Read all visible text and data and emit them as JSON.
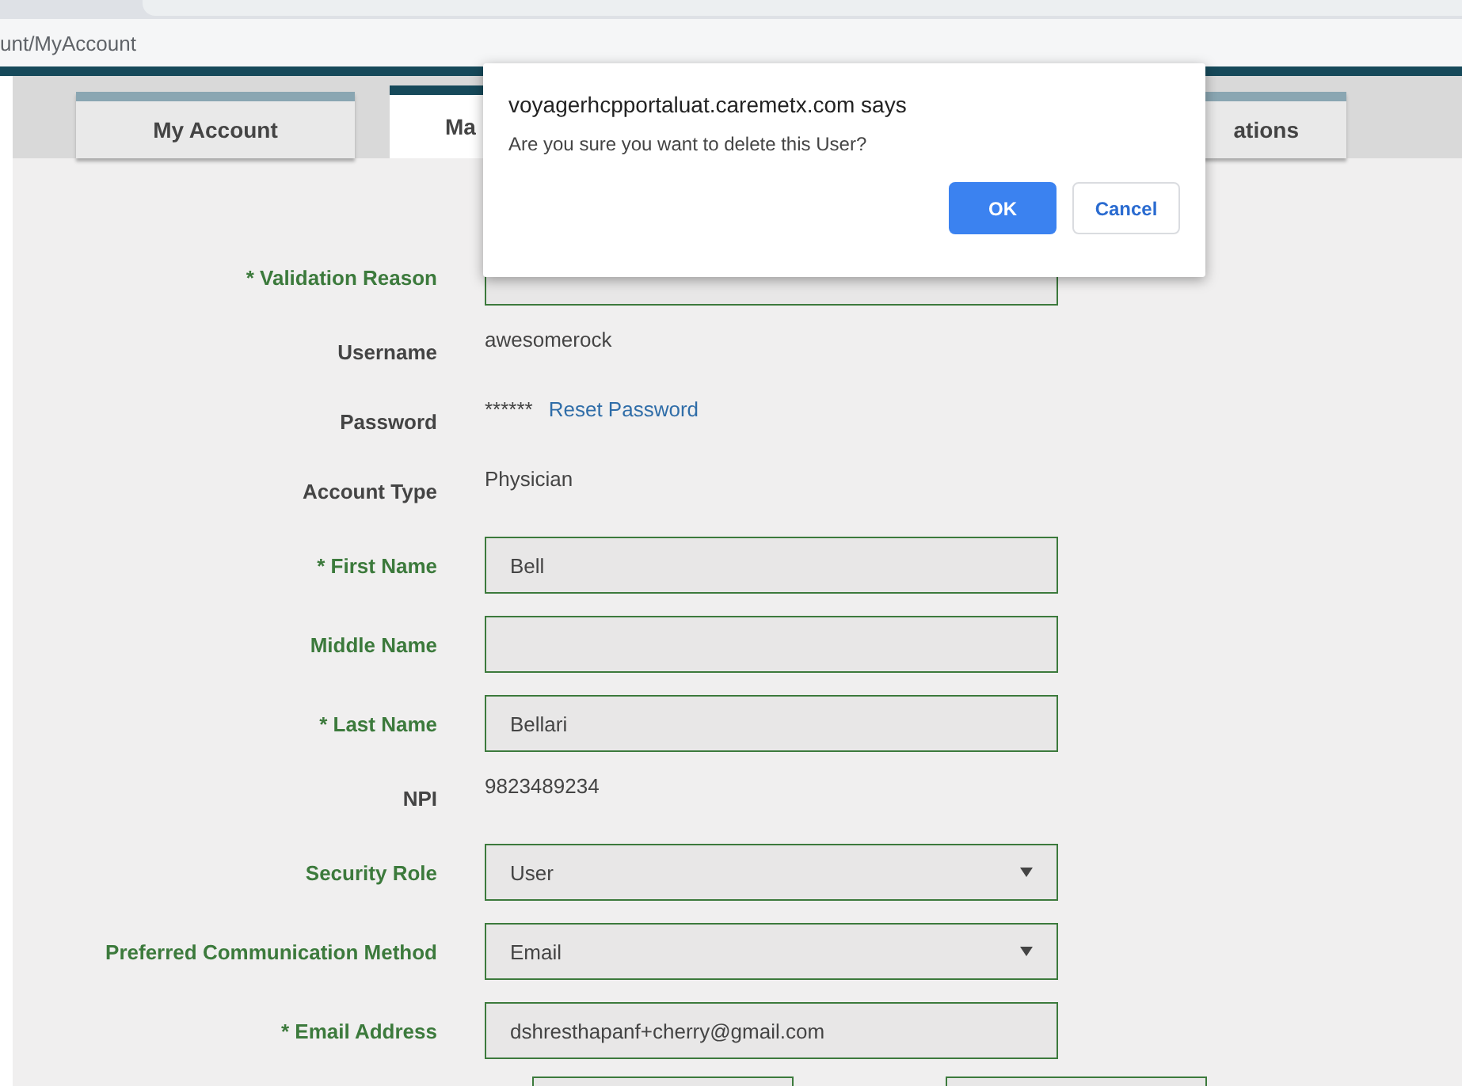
{
  "browser": {
    "url": "unt/MyAccount"
  },
  "tabs": [
    {
      "label": "My Account",
      "selected": false
    },
    {
      "label": "Ma",
      "selected": true
    },
    {
      "label": "ations",
      "selected": false
    }
  ],
  "form": [
    {
      "kind": "input",
      "label": "* Validation Reason"
    },
    {
      "kind": "text",
      "label": "Username",
      "value": "awesomerock"
    },
    {
      "kind": "password",
      "label": "Password",
      "value": "******",
      "link": "Reset Password"
    },
    {
      "kind": "text",
      "label": "Account Type",
      "value": "Physician"
    },
    {
      "kind": "input",
      "label": "* First Name",
      "value": "Bell"
    },
    {
      "kind": "input",
      "label": "Middle Name"
    },
    {
      "kind": "input",
      "label": "* Last Name",
      "value": "Bellari"
    },
    {
      "kind": "text",
      "label": "NPI",
      "value": "9823489234"
    },
    {
      "kind": "select",
      "label": "Security Role",
      "value": "User"
    },
    {
      "kind": "select",
      "label": "Preferred Communication Method",
      "value": "Email"
    },
    {
      "kind": "input",
      "label": "* Email Address",
      "value": "dshresthapanf+cherry@gmail.com"
    },
    {
      "kind": "pair"
    }
  ],
  "dialog": {
    "title": "voyagerhcpportaluat.caremetx.com says",
    "message": "Are you sure you want to delete this User?",
    "buttons": [
      {
        "label": "OK",
        "kind": "primary"
      },
      {
        "label": "Cancel",
        "kind": "secondary"
      }
    ]
  }
}
